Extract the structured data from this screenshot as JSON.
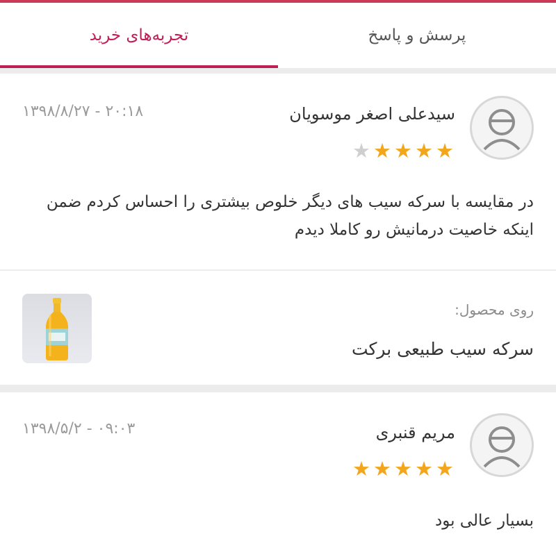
{
  "tabs": {
    "left_label": "تجربه‌های خرید",
    "right_label": "پرسش و پاسخ"
  },
  "reviews": [
    {
      "name": "سیدعلی اصغر موسویان",
      "datetime": "۲۰:۱۸ - ۱۳۹۸/۸/۲۷",
      "rating": 4,
      "max_rating": 5,
      "text": "در مقایسه با سرکه سیب های دیگر خلوص بیشتری را احساس کردم ضمن اینکه خاصیت درمانیش رو کاملا دیدم"
    },
    {
      "name": "مریم قنبری",
      "datetime": "۰۹:۰۳ - ۱۳۹۸/۵/۲",
      "rating": 5,
      "max_rating": 5,
      "text": "بسیار عالی بود"
    }
  ],
  "product": {
    "label": "روی محصول:",
    "name": "سرکه سیب طبیعی برکت"
  },
  "colors": {
    "accent": "#c21e56",
    "star": "#f3a61b",
    "star_empty": "#cfcfcf"
  },
  "icons": {
    "avatar": "user-avatar-icon",
    "star": "star-icon",
    "product": "vinegar-bottle-image"
  }
}
